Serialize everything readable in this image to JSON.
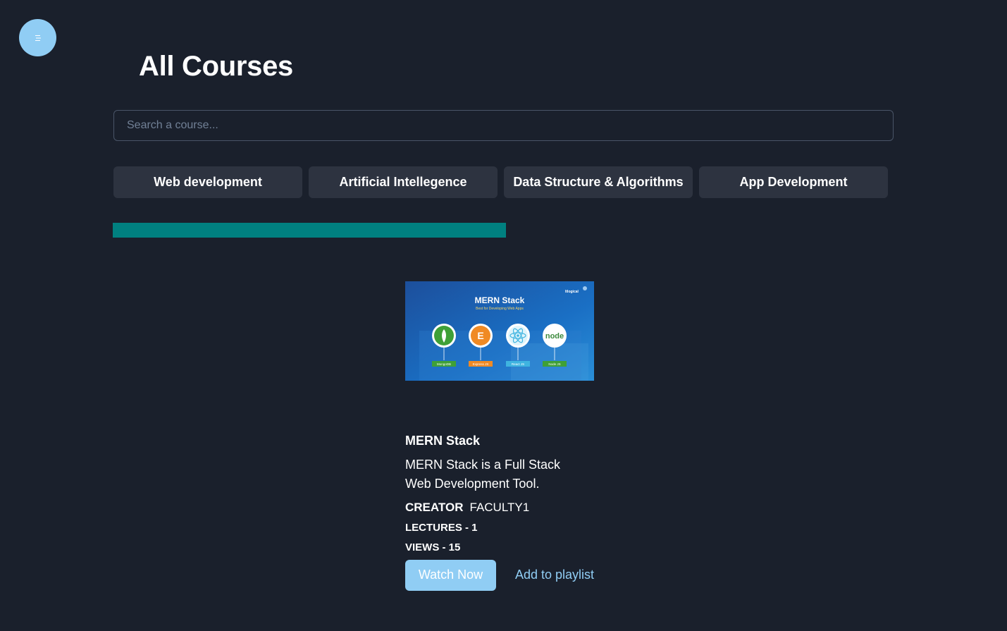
{
  "header": {
    "title": "All Courses",
    "menu_icon": "hamburger-icon"
  },
  "search": {
    "placeholder": "Search a course..."
  },
  "categories": [
    {
      "label": "Web development"
    },
    {
      "label": "Artificial Intellegence"
    },
    {
      "label": "Data Structure & Algorithms"
    },
    {
      "label": "App Development"
    }
  ],
  "colors": {
    "background": "#1a202c",
    "accent": "#90cdf4",
    "teal_bar": "#008080",
    "category_button": "#2d3340"
  },
  "course": {
    "thumbnail": {
      "title": "MERN Stack",
      "subtitle": "Best for Developing Web Apps",
      "brand": "Itlogical",
      "tech_labels": [
        "MongoDB",
        "Express JS",
        "React JS",
        "Node JS"
      ]
    },
    "title": "MERN Stack",
    "description": "MERN Stack is a Full Stack Web Development Tool.",
    "creator_label": "CREATOR",
    "creator": "FACULTY1",
    "lectures": "LECTURES - 1",
    "views": "VIEWS - 15",
    "watch_label": "Watch Now",
    "playlist_label": "Add to playlist"
  }
}
